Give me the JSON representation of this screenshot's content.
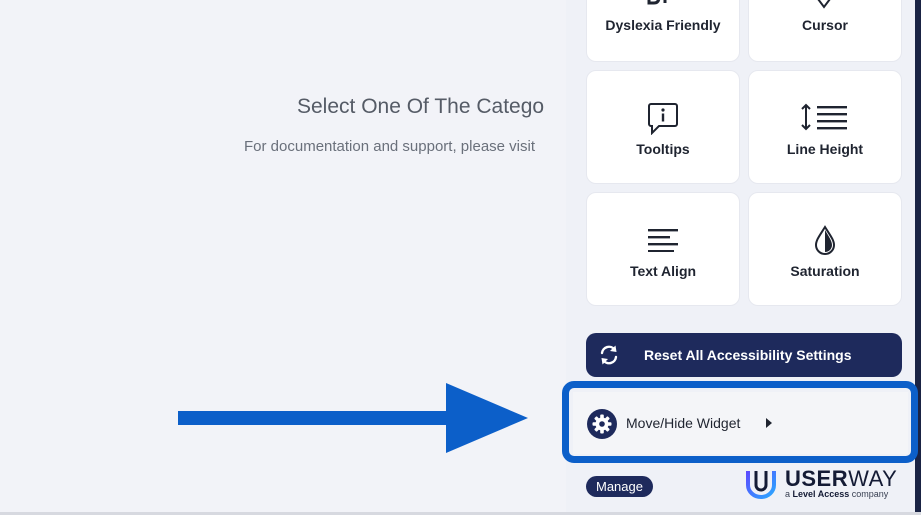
{
  "background": {
    "headline": "Select One Of The Catego",
    "subtext": "For documentation and support, please visit"
  },
  "tiles": [
    {
      "label": "Dyslexia Friendly",
      "icon": "dyslexia-font-icon"
    },
    {
      "label": "Cursor",
      "icon": "cursor-icon"
    },
    {
      "label": "Tooltips",
      "icon": "tooltip-icon"
    },
    {
      "label": "Line Height",
      "icon": "line-height-icon"
    },
    {
      "label": "Text Align",
      "icon": "text-align-icon"
    },
    {
      "label": "Saturation",
      "icon": "droplet-icon"
    }
  ],
  "reset": {
    "label": "Reset All Accessibility Settings",
    "icon": "refresh-icon"
  },
  "move_widget": {
    "label": "Move/Hide Widget",
    "icon": "gear-icon"
  },
  "footer": {
    "manage_label": "Manage",
    "brand_bold": "USER",
    "brand_light": "WAY",
    "tagline_prefix": "a",
    "tagline_bold": "Level Access",
    "tagline_suffix": "company"
  },
  "colors": {
    "accent_navy": "#1e2a5c",
    "highlight_blue": "#0c5fc9",
    "arrow_blue": "#0c5fc9"
  }
}
